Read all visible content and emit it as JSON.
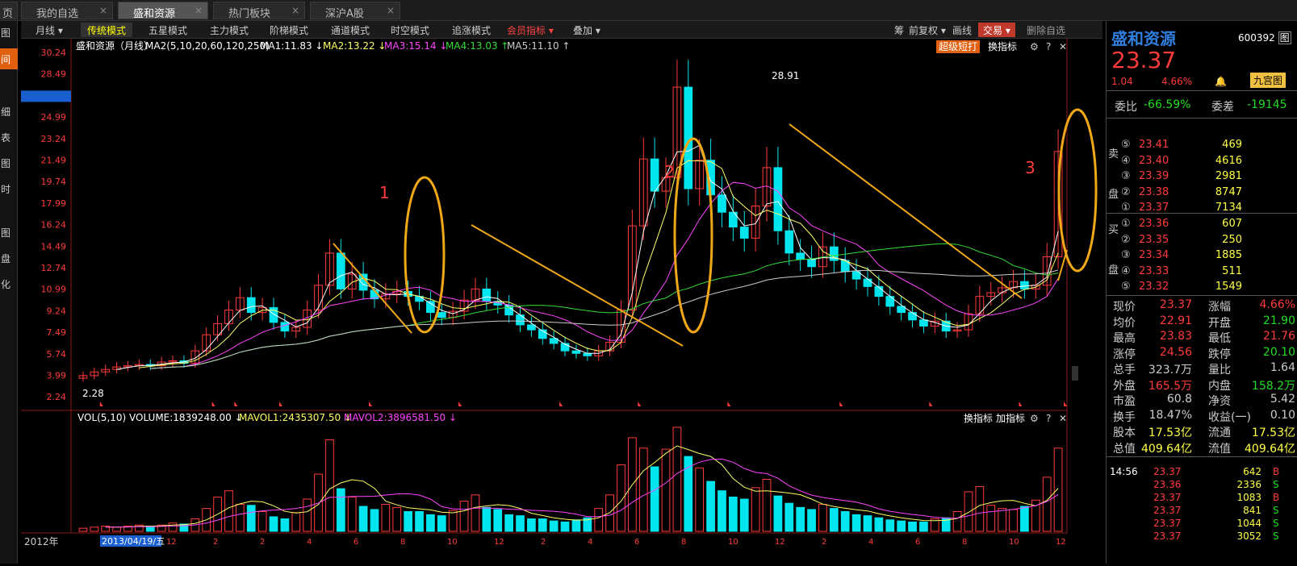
{
  "tabs": [
    {
      "label": "页"
    },
    {
      "label": "我的自选",
      "close": "×"
    },
    {
      "label": "盛和资源",
      "close": "×",
      "active": true
    },
    {
      "label": "热门板块",
      "close": "×"
    },
    {
      "label": "深沪A股",
      "close": "×"
    }
  ],
  "leftnav": [
    "图",
    "间",
    "细",
    "表",
    "图",
    "时",
    "图",
    "盘",
    "化"
  ],
  "toolbar": {
    "period": "月线",
    "modes": [
      "传统模式",
      "五星模式",
      "主力模式",
      "阶梯模式",
      "通道模式",
      "时空模式",
      "追涨模式"
    ],
    "member": "会员指标",
    "overlay": "叠加",
    "chou": "筹",
    "restore": "前复权",
    "draw": "画线",
    "trade": "交易",
    "delete": "删除自选"
  },
  "main_header": {
    "stock": "盛和资源（月线）",
    "ma_params": "MA2(5,10,20,60,120,250)",
    "ma1": "MA1:11.83 ↓",
    "ma2": "MA2:13.22 ↓",
    "ma3": "MA3:15.14 ↓",
    "ma4": "MA4:13.03 ↑",
    "ma5": "MA5:11.10 ↑",
    "super": "超级短打",
    "switch": "换指标"
  },
  "yaxis": [
    "30.24",
    "28.49",
    "26.26",
    "24.99",
    "23.24",
    "21.49",
    "19.74",
    "17.99",
    "16.24",
    "14.49",
    "12.74",
    "10.99",
    "9.24",
    "7.49",
    "5.74",
    "3.99",
    "2.24"
  ],
  "annotations": {
    "peak": "28.91",
    "low": "2.28",
    "n1": "1",
    "n2": "2",
    "n3": "3"
  },
  "vol_header": {
    "name": "VOL(5,10)",
    "volume": "VOLUME:1839248.00 ↓",
    "mavol1": "MAVOL1:2435307.50 ↓",
    "mavol2": "MAVOL2:3896581.50 ↓",
    "switch": "换指标",
    "add": "加指标"
  },
  "xaxis": {
    "year": "2012年",
    "date": "2013/04/19/五",
    "months": [
      "12",
      "2",
      "2",
      "4",
      "6",
      "8",
      "10",
      "12",
      "2",
      "4",
      "6",
      "8",
      "10",
      "12",
      "2",
      "4",
      "6",
      "8",
      "10",
      "12"
    ]
  },
  "chart_data": {
    "type": "candlestick",
    "title": "盛和资源（月线）",
    "ylim": [
      2.24,
      30.24
    ],
    "visible_points": {
      "high": 28.91,
      "low": 2.28,
      "crosshair_price": 26.26
    },
    "moving_averages": [
      {
        "name": "MA1",
        "value": 11.83,
        "color": "#ffffff"
      },
      {
        "name": "MA2",
        "value": 13.22,
        "color": "#ffff66"
      },
      {
        "name": "MA3",
        "value": 15.14,
        "color": "#ff44ff"
      },
      {
        "name": "MA4",
        "value": 13.03,
        "color": "#33dd33"
      },
      {
        "name": "MA5",
        "value": 11.1,
        "color": "#cccccc"
      }
    ],
    "close_series": [
      4.2,
      4.5,
      4.7,
      4.9,
      5.0,
      5.1,
      5.0,
      5.3,
      5.4,
      5.2,
      6.2,
      7.5,
      8.4,
      9.5,
      10.5,
      9.3,
      9.7,
      8.5,
      7.8,
      8.1,
      9.5,
      11.5,
      14.1,
      11.2,
      12.4,
      11.1,
      10.4,
      10.8,
      11.0,
      10.6,
      10.2,
      9.3,
      8.9,
      9.4,
      10.3,
      11.2,
      10.2,
      9.9,
      9.1,
      8.3,
      7.9,
      7.2,
      6.8,
      6.2,
      6.0,
      5.8,
      6.2,
      6.9,
      9.5,
      16.3,
      21.7,
      19.1,
      20.2,
      27.5,
      19.3,
      21.6,
      18.8,
      17.4,
      16.2,
      15.3,
      17.9,
      21.0,
      15.9,
      14.1,
      13.6,
      13.0,
      14.6,
      13.5,
      12.6,
      12.0,
      11.4,
      10.6,
      9.8,
      9.3,
      8.7,
      8.2,
      8.6,
      7.8,
      7.9,
      9.2,
      10.6,
      10.9,
      11.3,
      11.8,
      11.2,
      11.5,
      13.8,
      22.3
    ],
    "volume_series": [
      0.3,
      0.4,
      0.5,
      0.4,
      0.5,
      0.6,
      0.5,
      0.6,
      0.8,
      0.7,
      1.2,
      2.2,
      3.3,
      3.9,
      2.6,
      2.5,
      1.9,
      1.4,
      1.2,
      1.8,
      3.1,
      5.5,
      8.8,
      4.1,
      3.3,
      2.4,
      2.1,
      2.6,
      2.3,
      1.9,
      1.9,
      1.6,
      1.5,
      2.0,
      2.9,
      3.5,
      2.3,
      2.1,
      1.6,
      1.5,
      1.2,
      1.2,
      1.0,
      0.9,
      1.1,
      1.3,
      2.2,
      3.5,
      6.4,
      9.0,
      8.0,
      6.2,
      7.9,
      10.0,
      7.2,
      6.1,
      4.8,
      3.9,
      3.3,
      3.1,
      4.2,
      5.0,
      3.4,
      2.7,
      2.3,
      2.1,
      2.6,
      2.2,
      1.9,
      1.6,
      1.5,
      1.3,
      1.1,
      1.0,
      0.9,
      0.9,
      1.2,
      1.3,
      1.9,
      3.8,
      4.3,
      2.5,
      2.2,
      2.1,
      2.4,
      3.0,
      5.2,
      8.0
    ]
  },
  "quote": {
    "name": "盛和资源",
    "code": "600392",
    "code_tag": "图",
    "price": "23.37",
    "change": "1.04",
    "pct": "4.66%",
    "bell": "🔔",
    "jgg": "九宫图",
    "weibi_label": "委比",
    "weibi": "-66.59%",
    "weicha_label": "委差",
    "weicha": "-19145",
    "sell_label": [
      "卖",
      "盘"
    ],
    "buy_label": [
      "买",
      "盘"
    ],
    "sell": [
      {
        "lv": "⑤",
        "price": "23.41",
        "vol": "469"
      },
      {
        "lv": "④",
        "price": "23.40",
        "vol": "4616"
      },
      {
        "lv": "③",
        "price": "23.39",
        "vol": "2981"
      },
      {
        "lv": "②",
        "price": "23.38",
        "vol": "8747"
      },
      {
        "lv": "①",
        "price": "23.37",
        "vol": "7134"
      }
    ],
    "buy": [
      {
        "lv": "①",
        "price": "23.36",
        "vol": "607"
      },
      {
        "lv": "②",
        "price": "23.35",
        "vol": "250"
      },
      {
        "lv": "③",
        "price": "23.34",
        "vol": "1885"
      },
      {
        "lv": "④",
        "price": "23.33",
        "vol": "511"
      },
      {
        "lv": "⑤",
        "price": "23.32",
        "vol": "1549"
      }
    ],
    "stats": [
      [
        "现价",
        "23.37",
        "涨幅",
        "4.66%"
      ],
      [
        "均价",
        "22.91",
        "开盘",
        "21.90"
      ],
      [
        "最高",
        "23.83",
        "最低",
        "21.76"
      ],
      [
        "涨停",
        "24.56",
        "跌停",
        "20.10"
      ],
      [
        "总手",
        "323.7万",
        "量比",
        "1.64"
      ],
      [
        "外盘",
        "165.5万",
        "内盘",
        "158.2万"
      ],
      [
        "市盈",
        "60.8",
        "净资",
        "5.42"
      ],
      [
        "换手",
        "18.47%",
        "收益(一)",
        "0.10"
      ],
      [
        "股本",
        "17.53亿",
        "流通",
        "17.53亿"
      ],
      [
        "总值",
        "409.64亿",
        "流值",
        "409.64亿"
      ]
    ],
    "ticks": [
      {
        "time": "14:56",
        "price": "23.37",
        "vol": "642",
        "side": "B"
      },
      {
        "time": "",
        "price": "23.36",
        "vol": "2336",
        "side": "S"
      },
      {
        "time": "",
        "price": "23.37",
        "vol": "1083",
        "side": "B"
      },
      {
        "time": "",
        "price": "23.37",
        "vol": "841",
        "side": "S"
      },
      {
        "time": "",
        "price": "23.37",
        "vol": "1044",
        "side": "S"
      },
      {
        "time": "",
        "price": "23.37",
        "vol": "3052",
        "side": "S"
      }
    ]
  },
  "colors": {
    "up": "#ff3b3b",
    "down": "#00e5ee",
    "accent": "#f0a818",
    "blue": "#2f7fe0"
  }
}
